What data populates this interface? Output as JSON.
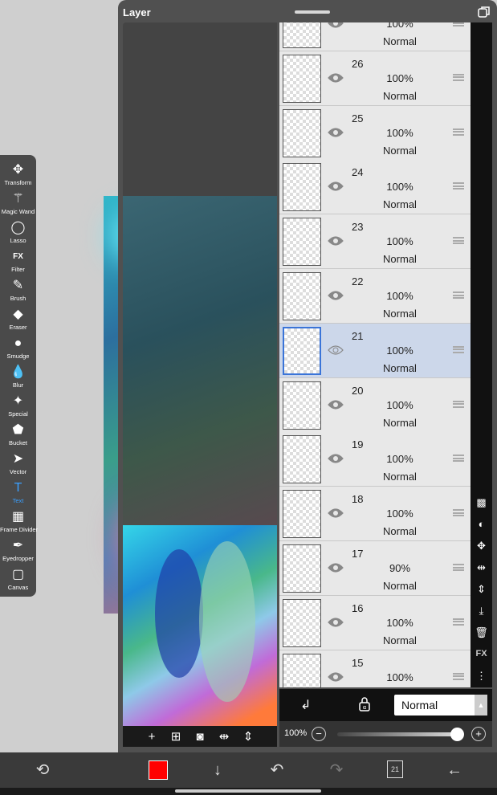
{
  "panel": {
    "title": "Layer"
  },
  "tools": [
    {
      "label": "Transform",
      "icon": "move-icon",
      "glyph": "✥"
    },
    {
      "label": "Magic Wand",
      "icon": "magic-wand-icon",
      "glyph": "⚚"
    },
    {
      "label": "Lasso",
      "icon": "lasso-icon",
      "glyph": "◯"
    },
    {
      "label": "Filter",
      "icon": "fx-icon",
      "glyph": "FX"
    },
    {
      "label": "Brush",
      "icon": "brush-icon",
      "glyph": "✎"
    },
    {
      "label": "Eraser",
      "icon": "eraser-icon",
      "glyph": "◆"
    },
    {
      "label": "Smudge",
      "icon": "smudge-icon",
      "glyph": "●"
    },
    {
      "label": "Blur",
      "icon": "blur-icon",
      "glyph": "💧"
    },
    {
      "label": "Special",
      "icon": "special-icon",
      "glyph": "✦"
    },
    {
      "label": "Bucket",
      "icon": "bucket-icon",
      "glyph": "⬟"
    },
    {
      "label": "Vector",
      "icon": "vector-icon",
      "glyph": "➤"
    },
    {
      "label": "Text",
      "icon": "text-icon",
      "glyph": "T"
    },
    {
      "label": "Frame Divider",
      "icon": "frame-divider-icon",
      "glyph": "▦"
    },
    {
      "label": "Eyedropper",
      "icon": "eyedropper-icon",
      "glyph": "✒"
    },
    {
      "label": "Canvas",
      "icon": "canvas-icon",
      "glyph": "▢"
    }
  ],
  "active_tool": "Text",
  "layers": [
    {
      "number": "",
      "opacity": "100%",
      "mode": "Normal",
      "selected": false
    },
    {
      "number": "26",
      "opacity": "100%",
      "mode": "Normal",
      "selected": false
    },
    {
      "number": "25",
      "opacity": "100%",
      "mode": "Normal",
      "selected": false
    },
    {
      "number": "24",
      "opacity": "100%",
      "mode": "Normal",
      "selected": false
    },
    {
      "number": "23",
      "opacity": "100%",
      "mode": "Normal",
      "selected": false
    },
    {
      "number": "22",
      "opacity": "100%",
      "mode": "Normal",
      "selected": false
    },
    {
      "number": "21",
      "opacity": "100%",
      "mode": "Normal",
      "selected": true
    },
    {
      "number": "20",
      "opacity": "100%",
      "mode": "Normal",
      "selected": false
    },
    {
      "number": "19",
      "opacity": "100%",
      "mode": "Normal",
      "selected": false
    },
    {
      "number": "18",
      "opacity": "100%",
      "mode": "Normal",
      "selected": false
    },
    {
      "number": "17",
      "opacity": "90%",
      "mode": "Normal",
      "selected": false
    },
    {
      "number": "16",
      "opacity": "100%",
      "mode": "Normal",
      "selected": false
    },
    {
      "number": "15",
      "opacity": "100%",
      "mode": "",
      "selected": false
    }
  ],
  "side_icons": [
    "transparency-icon",
    "contrast-icon",
    "move-layer-icon",
    "flip-horizontal-icon",
    "flip-vertical-icon",
    "merge-down-icon",
    "trash-icon",
    "fx-layer-icon",
    "more-icon"
  ],
  "blend_mode": {
    "value": "Normal"
  },
  "layer_opacity": {
    "label": "100%",
    "value": 1.0
  },
  "thumb_bar_icons": [
    "add-layer-icon",
    "add-special-layer-icon",
    "camera-icon",
    "flip-icon",
    "flip-vertical-icon"
  ],
  "bottom_bar": {
    "primary_color": "#ff0000",
    "page_count": "21"
  }
}
